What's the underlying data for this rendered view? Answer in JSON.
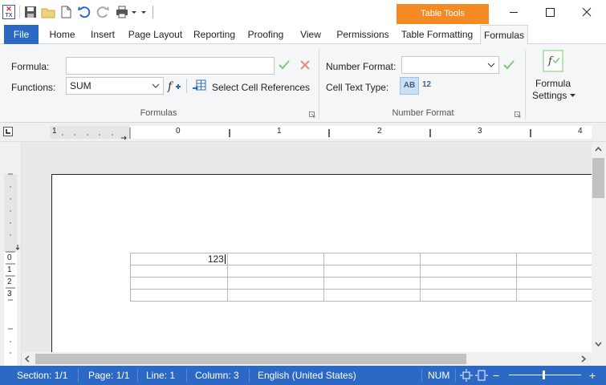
{
  "titlebar": {
    "contextual_tab": "Table Tools"
  },
  "tabs": [
    {
      "label": "File"
    },
    {
      "label": "Home"
    },
    {
      "label": "Insert"
    },
    {
      "label": "Page Layout"
    },
    {
      "label": "Reporting"
    },
    {
      "label": "Proofing"
    },
    {
      "label": "View"
    },
    {
      "label": "Permissions"
    },
    {
      "label": "Table Formatting"
    },
    {
      "label": "Formulas"
    }
  ],
  "ribbon": {
    "formula_label": "Formula:",
    "formula_value": "",
    "functions_label": "Functions:",
    "functions_value": "SUM",
    "select_refs_label": "Select Cell References",
    "formulas_group": "Formulas",
    "number_format_label": "Number Format:",
    "number_format_value": "",
    "cell_text_type_label": "Cell Text Type:",
    "cell_type_ab": "AB",
    "cell_type_12": "12",
    "number_format_group": "Number Format",
    "formula_settings_line1": "Formula",
    "formula_settings_line2": "Settings"
  },
  "ruler": {
    "h_labels": [
      "1",
      "0",
      "1",
      "2",
      "3",
      "4"
    ],
    "v_labels": [
      "0",
      "1",
      "2",
      "3"
    ]
  },
  "document": {
    "table": [
      [
        "123",
        "",
        "",
        "",
        ""
      ],
      [
        "",
        "",
        "",
        "",
        ""
      ],
      [
        "",
        "",
        "",
        "",
        ""
      ],
      [
        "",
        "",
        "",
        "",
        ""
      ]
    ]
  },
  "statusbar": {
    "section": "Section: 1/1",
    "page": "Page: 1/1",
    "line": "Line: 1",
    "column": "Column: 3",
    "language": "English (United States)",
    "num": "NUM",
    "zoom_minus": "−",
    "zoom_plus": "+"
  },
  "colors": {
    "accent": "#2b69c4",
    "contextual": "#f58a25"
  }
}
